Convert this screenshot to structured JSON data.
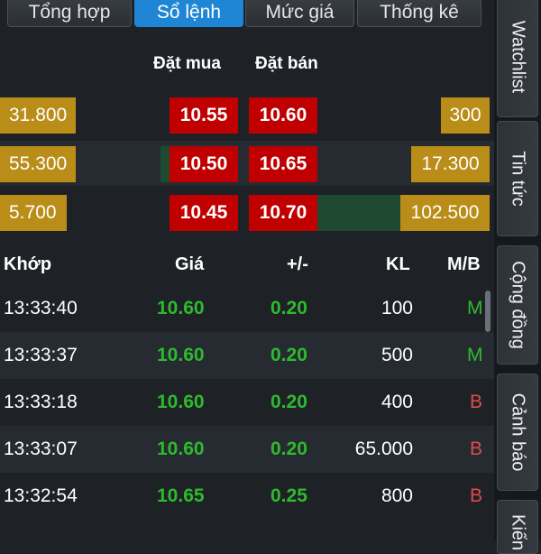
{
  "tabs": [
    "Tổng hợp",
    "Sổ lệnh",
    "Mức giá",
    "Thống kê"
  ],
  "active_tab": "Sổ lệnh",
  "orderbook": {
    "bid_header": "Đặt mua",
    "ask_header": "Đặt bán",
    "rows": [
      {
        "bid_vol": "31.800",
        "bid_price": "10.55",
        "ask_price": "10.60",
        "ask_vol": "300"
      },
      {
        "bid_vol": "55.300",
        "bid_price": "10.50",
        "ask_price": "10.65",
        "ask_vol": "17.300"
      },
      {
        "bid_vol": "5.700",
        "bid_price": "10.45",
        "ask_price": "10.70",
        "ask_vol": "102.500"
      }
    ]
  },
  "trades": {
    "headers": {
      "time": "Khớp",
      "price": "Giá",
      "change": "+/-",
      "volume": "KL",
      "side": "M/B"
    },
    "rows": [
      {
        "time": "13:33:40",
        "price": "10.60",
        "change": "0.20",
        "volume": "100",
        "side": "M"
      },
      {
        "time": "13:33:37",
        "price": "10.60",
        "change": "0.20",
        "volume": "500",
        "side": "M"
      },
      {
        "time": "13:33:18",
        "price": "10.60",
        "change": "0.20",
        "volume": "400",
        "side": "B"
      },
      {
        "time": "13:33:07",
        "price": "10.60",
        "change": "0.20",
        "volume": "65.000",
        "side": "B"
      },
      {
        "time": "13:32:54",
        "price": "10.65",
        "change": "0.25",
        "volume": "800",
        "side": "B"
      }
    ]
  },
  "sidebar": [
    "Watchlist",
    "Tin tức",
    "Cộng đồng",
    "Cảnh báo",
    "Kiến"
  ],
  "colors": {
    "active_tab": "#1f86d6",
    "gold": "#b98d18",
    "red": "#c00000",
    "green": "#2dbb2d",
    "sell": "#e04a4a"
  }
}
